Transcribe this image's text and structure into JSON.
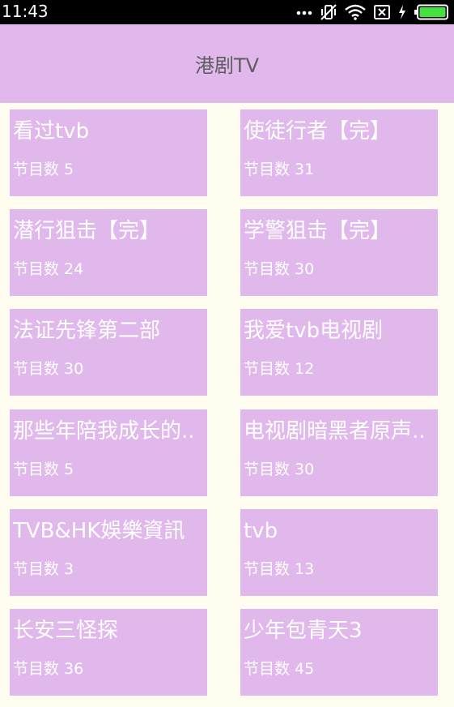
{
  "status_bar": {
    "time": "11:43",
    "icons": [
      "more-dots-icon",
      "vibrate-off-icon",
      "wifi-icon",
      "no-sim-icon",
      "charging-icon",
      "battery-icon"
    ]
  },
  "app_bar": {
    "title": "港剧TV"
  },
  "colors": {
    "app_bar_bg": "#e1b8ec",
    "card_bg": "#e1b8ec",
    "page_bg": "#fffcf0",
    "battery": "#44e13e"
  },
  "cards": [
    {
      "title": "看过tvb",
      "count": "节目数 5"
    },
    {
      "title": "使徒行者【完】",
      "count": "节目数 31"
    },
    {
      "title": "潜行狙击【完】",
      "count": "节目数 24"
    },
    {
      "title": "学警狙击【完】",
      "count": "节目数 30"
    },
    {
      "title": "法证先锋第二部",
      "count": "节目数 30"
    },
    {
      "title": "我爱tvb电视剧",
      "count": "节目数 12"
    },
    {
      "title": "那些年陪我成长的..",
      "count": "节目数 5"
    },
    {
      "title": "电视剧暗黑者原声..",
      "count": "节目数 30"
    },
    {
      "title": "TVB&HK娛樂資訊",
      "count": "节目数 3"
    },
    {
      "title": "tvb",
      "count": "节目数 13"
    },
    {
      "title": "长安三怪探",
      "count": "节目数 36"
    },
    {
      "title": "少年包青天3",
      "count": "节目数 45"
    }
  ]
}
